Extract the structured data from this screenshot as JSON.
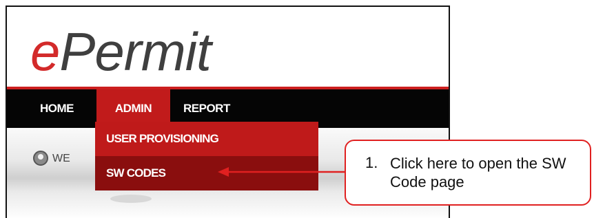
{
  "app": {
    "logo_e": "e",
    "logo_rest": "Permit",
    "brand_red": "#d32a2a"
  },
  "nav": {
    "items": [
      {
        "label": "HOME"
      },
      {
        "label": "ADMIN",
        "active": true
      },
      {
        "label": "REPORT"
      }
    ]
  },
  "welcome": {
    "text": "WE",
    "icon": "user-icon"
  },
  "dropdown": {
    "items": [
      {
        "label": "USER PROVISIONING"
      },
      {
        "label": "SW CODES",
        "highlighted": true
      }
    ]
  },
  "callout": {
    "number": "1.",
    "text": "Click here to open the SW Code page",
    "border_color": "#e02020"
  }
}
